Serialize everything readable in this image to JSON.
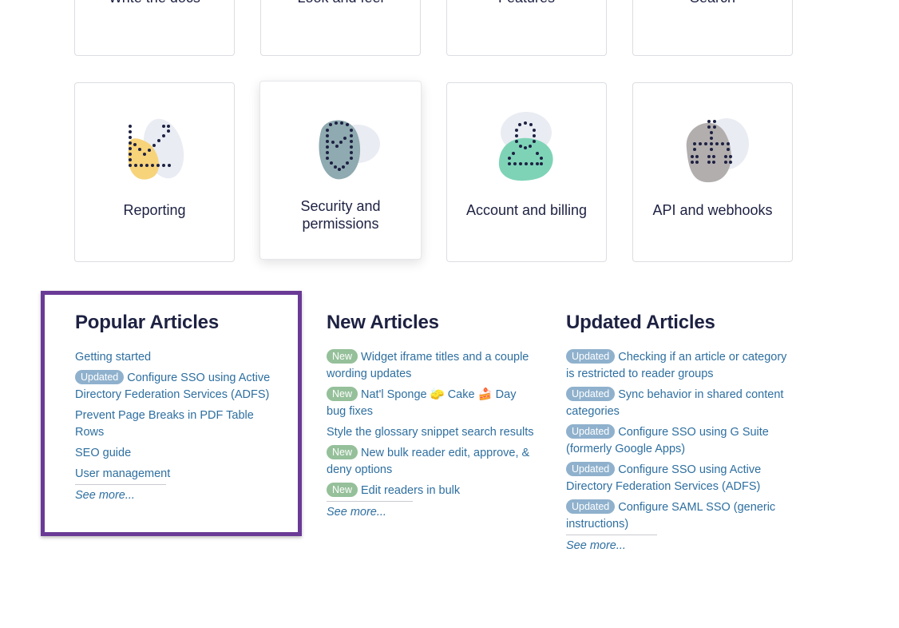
{
  "categories_top": [
    {
      "label": "Write the docs"
    },
    {
      "label": "Look and feel"
    },
    {
      "label": "Features"
    },
    {
      "label": "Search"
    }
  ],
  "categories": [
    {
      "label": "Reporting",
      "icon": "chart-icon",
      "blob": "#f7d37a"
    },
    {
      "label": "Security and permissions",
      "icon": "shield-check-icon",
      "blob": "#8faab0"
    },
    {
      "label": "Account and billing",
      "icon": "user-icon",
      "blob": "#7ed3b7"
    },
    {
      "label": "API and webhooks",
      "icon": "network-icon",
      "blob": "#b3aeae"
    }
  ],
  "popular": {
    "title": "Popular Articles",
    "items": [
      {
        "label": "Getting started"
      },
      {
        "badge": "Updated",
        "label": "Configure SSO using Active Directory Federation Services (ADFS)"
      },
      {
        "label": "Prevent Page Breaks in PDF Table Rows"
      },
      {
        "label": "SEO guide"
      },
      {
        "label": "User management"
      }
    ],
    "see_more": "See more..."
  },
  "new": {
    "title": "New Articles",
    "items": [
      {
        "badge": "New",
        "label": "Widget iframe titles and a couple wording updates"
      },
      {
        "badge": "New",
        "label": "Nat'l Sponge 🧽 Cake 🍰 Day bug fixes"
      },
      {
        "label": "Style the glossary snippet search results"
      },
      {
        "badge": "New",
        "label": "New bulk reader edit, approve, & deny options"
      },
      {
        "badge": "New",
        "label": "Edit readers in bulk"
      }
    ],
    "see_more": "See more..."
  },
  "updated": {
    "title": "Updated Articles",
    "items": [
      {
        "badge": "Updated",
        "label": "Checking if an article or category is restricted to reader groups"
      },
      {
        "badge": "Updated",
        "label": "Sync behavior in shared content categories"
      },
      {
        "badge": "Updated",
        "label": "Configure SSO using G Suite (formerly Google Apps)"
      },
      {
        "badge": "Updated",
        "label": "Configure SSO using Active Directory Federation Services (ADFS)"
      },
      {
        "badge": "Updated",
        "label": "Configure SAML SSO (generic instructions)"
      }
    ],
    "see_more": "See more..."
  },
  "colors": {
    "link": "#2e6fa0",
    "highlight_border": "#6a3a96",
    "badge_new": "#95c09a",
    "badge_updated": "#8fb1cd"
  }
}
